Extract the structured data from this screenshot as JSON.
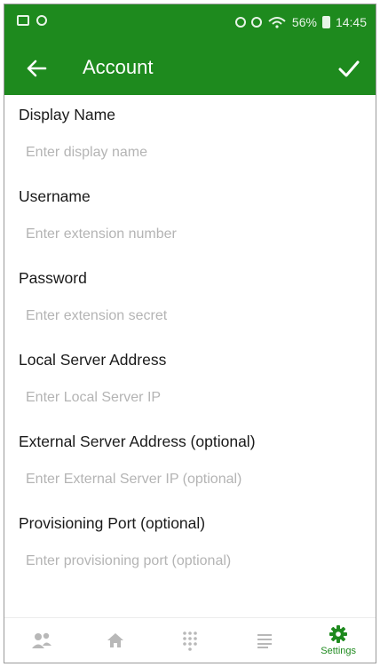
{
  "status_bar": {
    "battery": "56%",
    "time": "14:45"
  },
  "app_bar": {
    "title": "Account",
    "back_icon": "arrow-left-icon",
    "save_icon": "checkmark-icon"
  },
  "fields": [
    {
      "label": "Display Name",
      "placeholder": "Enter display name",
      "value": ""
    },
    {
      "label": "Username",
      "placeholder": "Enter extension number",
      "value": ""
    },
    {
      "label": "Password",
      "placeholder": "Enter extension secret",
      "value": ""
    },
    {
      "label": "Local Server Address",
      "placeholder": "Enter Local Server IP",
      "value": ""
    },
    {
      "label": "External Server Address (optional)",
      "placeholder": "Enter External Server IP (optional)",
      "value": ""
    },
    {
      "label": "Provisioning Port (optional)",
      "placeholder": "Enter provisioning port (optional)",
      "value": ""
    }
  ],
  "bottom_nav": {
    "items": [
      {
        "icon": "contacts-icon"
      },
      {
        "icon": "home-icon"
      },
      {
        "icon": "dialpad-icon"
      },
      {
        "icon": "list-icon"
      },
      {
        "icon": "gear-icon",
        "label": "Settings",
        "active": true
      }
    ]
  },
  "colors": {
    "primary": "#1e8a1e",
    "inactive_icon": "#b8b8b8",
    "placeholder": "#b4b4b4"
  }
}
